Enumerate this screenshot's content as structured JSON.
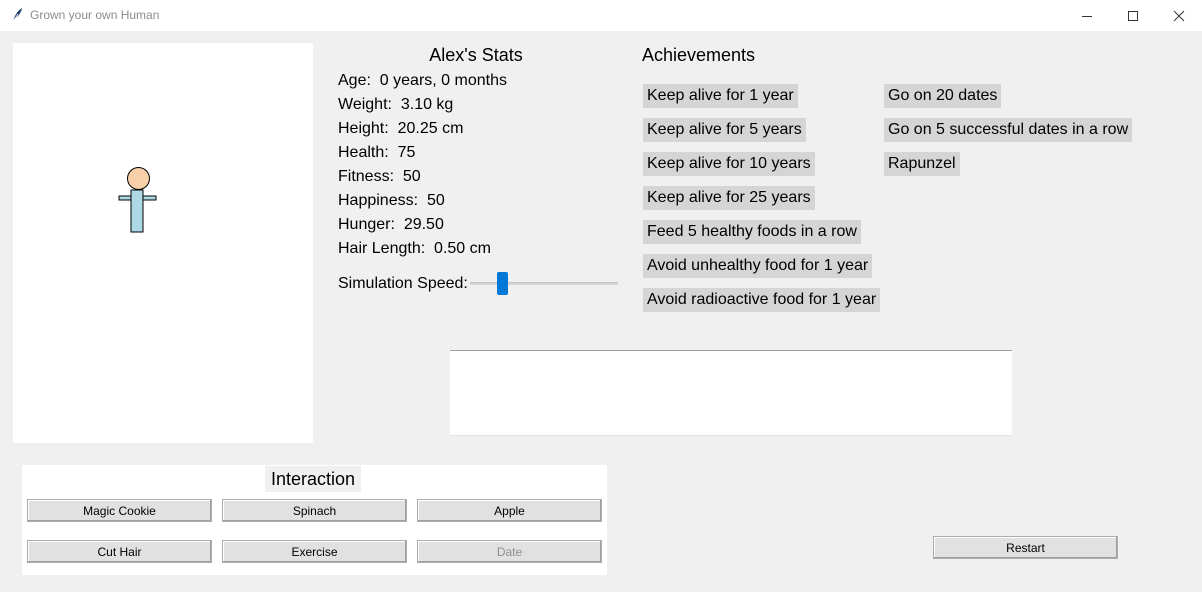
{
  "window": {
    "title": "Grown your own Human"
  },
  "stats": {
    "title": "Alex's Stats",
    "age": "Age:  0 years, 0 months",
    "weight": "Weight:  3.10 kg",
    "height": "Height:  20.25 cm",
    "health": "Health:  75",
    "fitness": "Fitness:  50",
    "happiness": "Happiness:  50",
    "hunger": "Hunger:  29.50",
    "hair_length": "Hair Length:  0.50 cm",
    "speed_label": "Simulation Speed:",
    "speed_level": 0.2
  },
  "achievements": {
    "title": "Achievements",
    "items": [
      "Keep alive for 1 year",
      "Keep alive for 5 years",
      "Keep alive for 10 years",
      "Keep alive for 25 years",
      "Feed 5 healthy foods in a row",
      "Avoid unhealthy food for 1 year",
      "Avoid radioactive food for 1 year",
      "Go on 20 dates",
      "Go on 5 successful dates in a row",
      "Rapunzel"
    ]
  },
  "message": "",
  "interaction": {
    "title": "Interaction",
    "buttons": {
      "magic_cookie": "Magic Cookie",
      "spinach": "Spinach",
      "apple": "Apple",
      "cut_hair": "Cut Hair",
      "exercise": "Exercise",
      "date": "Date"
    }
  },
  "restart_label": "Restart",
  "colors": {
    "head": "#f7cfa8",
    "body": "#add8e6",
    "slider_accent": "#0078d7",
    "achievement_bg": "#d5d5d5"
  },
  "icons": [
    "feather-icon",
    "minimize-icon",
    "maximize-icon",
    "close-icon"
  ]
}
